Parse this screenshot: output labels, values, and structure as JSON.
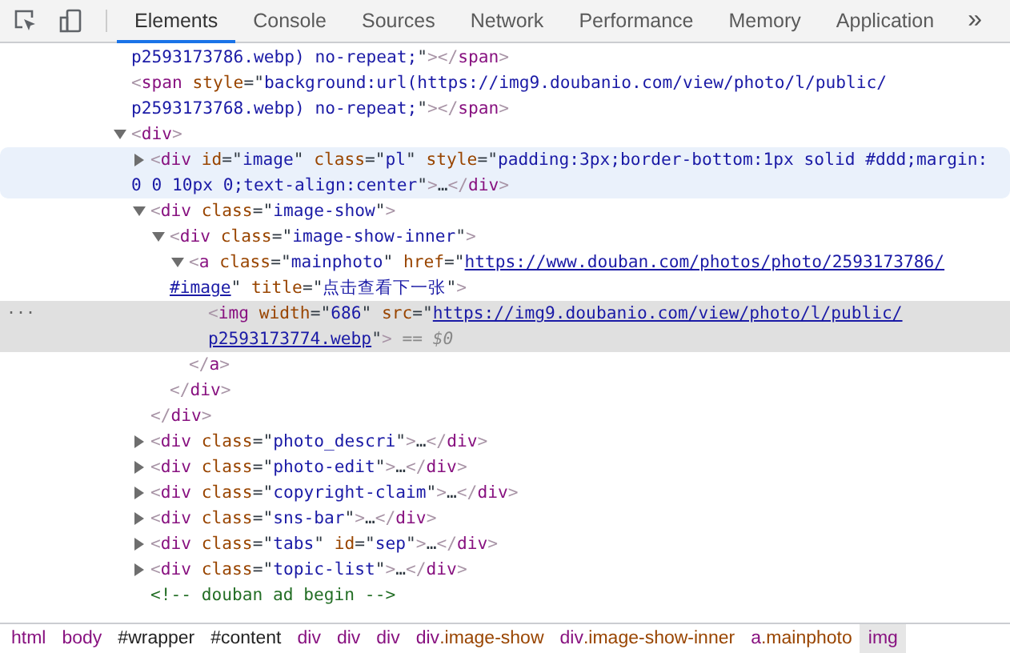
{
  "toolbar": {
    "tabs": [
      {
        "label": "Elements",
        "selected": true
      },
      {
        "label": "Console",
        "selected": false
      },
      {
        "label": "Sources",
        "selected": false
      },
      {
        "label": "Network",
        "selected": false
      },
      {
        "label": "Performance",
        "selected": false
      },
      {
        "label": "Memory",
        "selected": false
      },
      {
        "label": "Application",
        "selected": false
      }
    ],
    "overflow": "»"
  },
  "selection_marker": "...",
  "dom": [
    {
      "selected": false,
      "hovered": false,
      "lines": [
        [
          {
            "kind": "value",
            "text": "p2593173786.webp) no-repeat;"
          },
          {
            "kind": "quote",
            "text": "\""
          },
          {
            "kind": "bracket",
            "text": ">"
          },
          {
            "kind": "bracket",
            "text": "</"
          },
          {
            "kind": "tag",
            "text": "span"
          },
          {
            "kind": "bracket",
            "text": ">"
          }
        ]
      ]
    },
    {
      "selected": false,
      "hovered": false,
      "lines": [
        [
          {
            "kind": "bracket",
            "text": "<"
          },
          {
            "kind": "tag",
            "text": "span"
          },
          {
            "kind": "attr",
            "text": " style"
          },
          {
            "kind": "quote",
            "text": "=\""
          },
          {
            "kind": "value",
            "text": "background:url(https://img9.doubanio.com/view/photo/l/public/"
          }
        ],
        [
          {
            "kind": "value",
            "text": "p2593173768.webp) no-repeat;"
          },
          {
            "kind": "quote",
            "text": "\""
          },
          {
            "kind": "bracket",
            "text": ">"
          },
          {
            "kind": "bracket",
            "text": "</"
          },
          {
            "kind": "tag",
            "text": "span"
          },
          {
            "kind": "bracket",
            "text": ">"
          }
        ]
      ]
    },
    {
      "expanded": true,
      "selected": false,
      "hovered": false,
      "lines": [
        [
          {
            "kind": "bracket",
            "text": "<"
          },
          {
            "kind": "tag",
            "text": "div"
          },
          {
            "kind": "bracket",
            "text": ">"
          }
        ]
      ],
      "children": [
        {
          "expanded": false,
          "selected": false,
          "hovered": true,
          "lines": [
            [
              {
                "kind": "bracket",
                "text": "<"
              },
              {
                "kind": "tag",
                "text": "div"
              },
              {
                "kind": "attr",
                "text": " id"
              },
              {
                "kind": "quote",
                "text": "=\""
              },
              {
                "kind": "value",
                "text": "image"
              },
              {
                "kind": "quote",
                "text": "\""
              },
              {
                "kind": "attr",
                "text": " class"
              },
              {
                "kind": "quote",
                "text": "=\""
              },
              {
                "kind": "value",
                "text": "pl"
              },
              {
                "kind": "quote",
                "text": "\""
              },
              {
                "kind": "attr",
                "text": " style"
              },
              {
                "kind": "quote",
                "text": "=\""
              },
              {
                "kind": "value",
                "text": "padding:3px;border-bottom:1px solid #ddd;margin:"
              }
            ],
            [
              {
                "kind": "value",
                "text": "0 0 10px 0;text-align:center"
              },
              {
                "kind": "quote",
                "text": "\""
              },
              {
                "kind": "bracket",
                "text": ">"
              },
              {
                "kind": "dots",
                "text": "…"
              },
              {
                "kind": "bracket",
                "text": "</"
              },
              {
                "kind": "tag",
                "text": "div"
              },
              {
                "kind": "bracket",
                "text": ">"
              }
            ]
          ]
        },
        {
          "expanded": true,
          "selected": false,
          "hovered": false,
          "lines": [
            [
              {
                "kind": "bracket",
                "text": "<"
              },
              {
                "kind": "tag",
                "text": "div"
              },
              {
                "kind": "attr",
                "text": " class"
              },
              {
                "kind": "quote",
                "text": "=\""
              },
              {
                "kind": "value",
                "text": "image-show"
              },
              {
                "kind": "quote",
                "text": "\""
              },
              {
                "kind": "bracket",
                "text": ">"
              }
            ]
          ],
          "closing": [
            {
              "kind": "bracket",
              "text": "</"
            },
            {
              "kind": "tag",
              "text": "div"
            },
            {
              "kind": "bracket",
              "text": ">"
            }
          ],
          "children": [
            {
              "expanded": true,
              "selected": false,
              "hovered": false,
              "lines": [
                [
                  {
                    "kind": "bracket",
                    "text": "<"
                  },
                  {
                    "kind": "tag",
                    "text": "div"
                  },
                  {
                    "kind": "attr",
                    "text": " class"
                  },
                  {
                    "kind": "quote",
                    "text": "=\""
                  },
                  {
                    "kind": "value",
                    "text": "image-show-inner"
                  },
                  {
                    "kind": "quote",
                    "text": "\""
                  },
                  {
                    "kind": "bracket",
                    "text": ">"
                  }
                ]
              ],
              "closing": [
                {
                  "kind": "bracket",
                  "text": "</"
                },
                {
                  "kind": "tag",
                  "text": "div"
                },
                {
                  "kind": "bracket",
                  "text": ">"
                }
              ],
              "children": [
                {
                  "expanded": true,
                  "selected": false,
                  "hovered": false,
                  "lines": [
                    [
                      {
                        "kind": "bracket",
                        "text": "<"
                      },
                      {
                        "kind": "tag",
                        "text": "a"
                      },
                      {
                        "kind": "attr",
                        "text": " class"
                      },
                      {
                        "kind": "quote",
                        "text": "=\""
                      },
                      {
                        "kind": "value",
                        "text": "mainphoto"
                      },
                      {
                        "kind": "quote",
                        "text": "\""
                      },
                      {
                        "kind": "attr",
                        "text": " href"
                      },
                      {
                        "kind": "quote",
                        "text": "=\""
                      },
                      {
                        "kind": "link",
                        "text": "https://www.douban.com/photos/photo/2593173786/"
                      }
                    ],
                    [
                      {
                        "kind": "link",
                        "text": "#image"
                      },
                      {
                        "kind": "quote",
                        "text": "\""
                      },
                      {
                        "kind": "attr",
                        "text": " title"
                      },
                      {
                        "kind": "quote",
                        "text": "=\""
                      },
                      {
                        "kind": "value",
                        "text": "点击查看下一张"
                      },
                      {
                        "kind": "quote",
                        "text": "\""
                      },
                      {
                        "kind": "bracket",
                        "text": ">"
                      }
                    ]
                  ],
                  "closing": [
                    {
                      "kind": "bracket",
                      "text": "</"
                    },
                    {
                      "kind": "tag",
                      "text": "a"
                    },
                    {
                      "kind": "bracket",
                      "text": ">"
                    }
                  ],
                  "children": [
                    {
                      "selected": true,
                      "hovered": false,
                      "lines": [
                        [
                          {
                            "kind": "bracket",
                            "text": "<"
                          },
                          {
                            "kind": "tag",
                            "text": "img"
                          },
                          {
                            "kind": "attr",
                            "text": " width"
                          },
                          {
                            "kind": "quote",
                            "text": "=\""
                          },
                          {
                            "kind": "value",
                            "text": "686"
                          },
                          {
                            "kind": "quote",
                            "text": "\""
                          },
                          {
                            "kind": "attr",
                            "text": " src"
                          },
                          {
                            "kind": "quote",
                            "text": "=\""
                          },
                          {
                            "kind": "link",
                            "text": "https://img9.doubanio.com/view/photo/l/public/"
                          }
                        ],
                        [
                          {
                            "kind": "link",
                            "text": "p2593173774.webp"
                          },
                          {
                            "kind": "quote",
                            "text": "\""
                          },
                          {
                            "kind": "bracket",
                            "text": ">"
                          },
                          {
                            "kind": "hint",
                            "text": " == "
                          },
                          {
                            "kind": "var",
                            "text": "$0"
                          }
                        ]
                      ]
                    }
                  ]
                }
              ]
            }
          ]
        },
        {
          "expanded": false,
          "selected": false,
          "hovered": false,
          "lines": [
            [
              {
                "kind": "bracket",
                "text": "<"
              },
              {
                "kind": "tag",
                "text": "div"
              },
              {
                "kind": "attr",
                "text": " class"
              },
              {
                "kind": "quote",
                "text": "=\""
              },
              {
                "kind": "value",
                "text": "photo_descri"
              },
              {
                "kind": "quote",
                "text": "\""
              },
              {
                "kind": "bracket",
                "text": ">"
              },
              {
                "kind": "dots",
                "text": "…"
              },
              {
                "kind": "bracket",
                "text": "</"
              },
              {
                "kind": "tag",
                "text": "div"
              },
              {
                "kind": "bracket",
                "text": ">"
              }
            ]
          ]
        },
        {
          "expanded": false,
          "selected": false,
          "hovered": false,
          "lines": [
            [
              {
                "kind": "bracket",
                "text": "<"
              },
              {
                "kind": "tag",
                "text": "div"
              },
              {
                "kind": "attr",
                "text": " class"
              },
              {
                "kind": "quote",
                "text": "=\""
              },
              {
                "kind": "value",
                "text": "photo-edit"
              },
              {
                "kind": "quote",
                "text": "\""
              },
              {
                "kind": "bracket",
                "text": ">"
              },
              {
                "kind": "dots",
                "text": "…"
              },
              {
                "kind": "bracket",
                "text": "</"
              },
              {
                "kind": "tag",
                "text": "div"
              },
              {
                "kind": "bracket",
                "text": ">"
              }
            ]
          ]
        },
        {
          "expanded": false,
          "selected": false,
          "hovered": false,
          "lines": [
            [
              {
                "kind": "bracket",
                "text": "<"
              },
              {
                "kind": "tag",
                "text": "div"
              },
              {
                "kind": "attr",
                "text": " class"
              },
              {
                "kind": "quote",
                "text": "=\""
              },
              {
                "kind": "value",
                "text": "copyright-claim"
              },
              {
                "kind": "quote",
                "text": "\""
              },
              {
                "kind": "bracket",
                "text": ">"
              },
              {
                "kind": "dots",
                "text": "…"
              },
              {
                "kind": "bracket",
                "text": "</"
              },
              {
                "kind": "tag",
                "text": "div"
              },
              {
                "kind": "bracket",
                "text": ">"
              }
            ]
          ]
        },
        {
          "expanded": false,
          "selected": false,
          "hovered": false,
          "lines": [
            [
              {
                "kind": "bracket",
                "text": "<"
              },
              {
                "kind": "tag",
                "text": "div"
              },
              {
                "kind": "attr",
                "text": " class"
              },
              {
                "kind": "quote",
                "text": "=\""
              },
              {
                "kind": "value",
                "text": "sns-bar"
              },
              {
                "kind": "quote",
                "text": "\""
              },
              {
                "kind": "bracket",
                "text": ">"
              },
              {
                "kind": "dots",
                "text": "…"
              },
              {
                "kind": "bracket",
                "text": "</"
              },
              {
                "kind": "tag",
                "text": "div"
              },
              {
                "kind": "bracket",
                "text": ">"
              }
            ]
          ]
        },
        {
          "expanded": false,
          "selected": false,
          "hovered": false,
          "lines": [
            [
              {
                "kind": "bracket",
                "text": "<"
              },
              {
                "kind": "tag",
                "text": "div"
              },
              {
                "kind": "attr",
                "text": " class"
              },
              {
                "kind": "quote",
                "text": "=\""
              },
              {
                "kind": "value",
                "text": "tabs"
              },
              {
                "kind": "quote",
                "text": "\""
              },
              {
                "kind": "attr",
                "text": " id"
              },
              {
                "kind": "quote",
                "text": "=\""
              },
              {
                "kind": "value",
                "text": "sep"
              },
              {
                "kind": "quote",
                "text": "\""
              },
              {
                "kind": "bracket",
                "text": ">"
              },
              {
                "kind": "dots",
                "text": "…"
              },
              {
                "kind": "bracket",
                "text": "</"
              },
              {
                "kind": "tag",
                "text": "div"
              },
              {
                "kind": "bracket",
                "text": ">"
              }
            ]
          ]
        },
        {
          "expanded": false,
          "selected": false,
          "hovered": false,
          "lines": [
            [
              {
                "kind": "bracket",
                "text": "<"
              },
              {
                "kind": "tag",
                "text": "div"
              },
              {
                "kind": "attr",
                "text": " class"
              },
              {
                "kind": "quote",
                "text": "=\""
              },
              {
                "kind": "value",
                "text": "topic-list"
              },
              {
                "kind": "quote",
                "text": "\""
              },
              {
                "kind": "bracket",
                "text": ">"
              },
              {
                "kind": "dots",
                "text": "…"
              },
              {
                "kind": "bracket",
                "text": "</"
              },
              {
                "kind": "tag",
                "text": "div"
              },
              {
                "kind": "bracket",
                "text": ">"
              }
            ]
          ]
        },
        {
          "selected": false,
          "hovered": false,
          "lines": [
            [
              {
                "kind": "comment",
                "text": "<!-- douban ad begin -->"
              }
            ]
          ]
        }
      ]
    }
  ],
  "breadcrumbs": [
    {
      "selected": false,
      "parts": [
        {
          "kind": "tag",
          "text": "html"
        }
      ]
    },
    {
      "selected": false,
      "parts": [
        {
          "kind": "tag",
          "text": "body"
        }
      ]
    },
    {
      "selected": false,
      "parts": [
        {
          "kind": "id",
          "text": "#wrapper"
        }
      ]
    },
    {
      "selected": false,
      "parts": [
        {
          "kind": "id",
          "text": "#content"
        }
      ]
    },
    {
      "selected": false,
      "parts": [
        {
          "kind": "tag",
          "text": "div"
        }
      ]
    },
    {
      "selected": false,
      "parts": [
        {
          "kind": "tag",
          "text": "div"
        }
      ]
    },
    {
      "selected": false,
      "parts": [
        {
          "kind": "tag",
          "text": "div"
        }
      ]
    },
    {
      "selected": false,
      "parts": [
        {
          "kind": "tag",
          "text": "div"
        },
        {
          "kind": "class",
          "text": ".image-show"
        }
      ]
    },
    {
      "selected": false,
      "parts": [
        {
          "kind": "tag",
          "text": "div"
        },
        {
          "kind": "class",
          "text": ".image-show-inner"
        }
      ]
    },
    {
      "selected": false,
      "parts": [
        {
          "kind": "tag",
          "text": "a"
        },
        {
          "kind": "class",
          "text": ".mainphoto"
        }
      ]
    },
    {
      "selected": true,
      "parts": [
        {
          "kind": "tag",
          "text": "img"
        }
      ]
    }
  ]
}
